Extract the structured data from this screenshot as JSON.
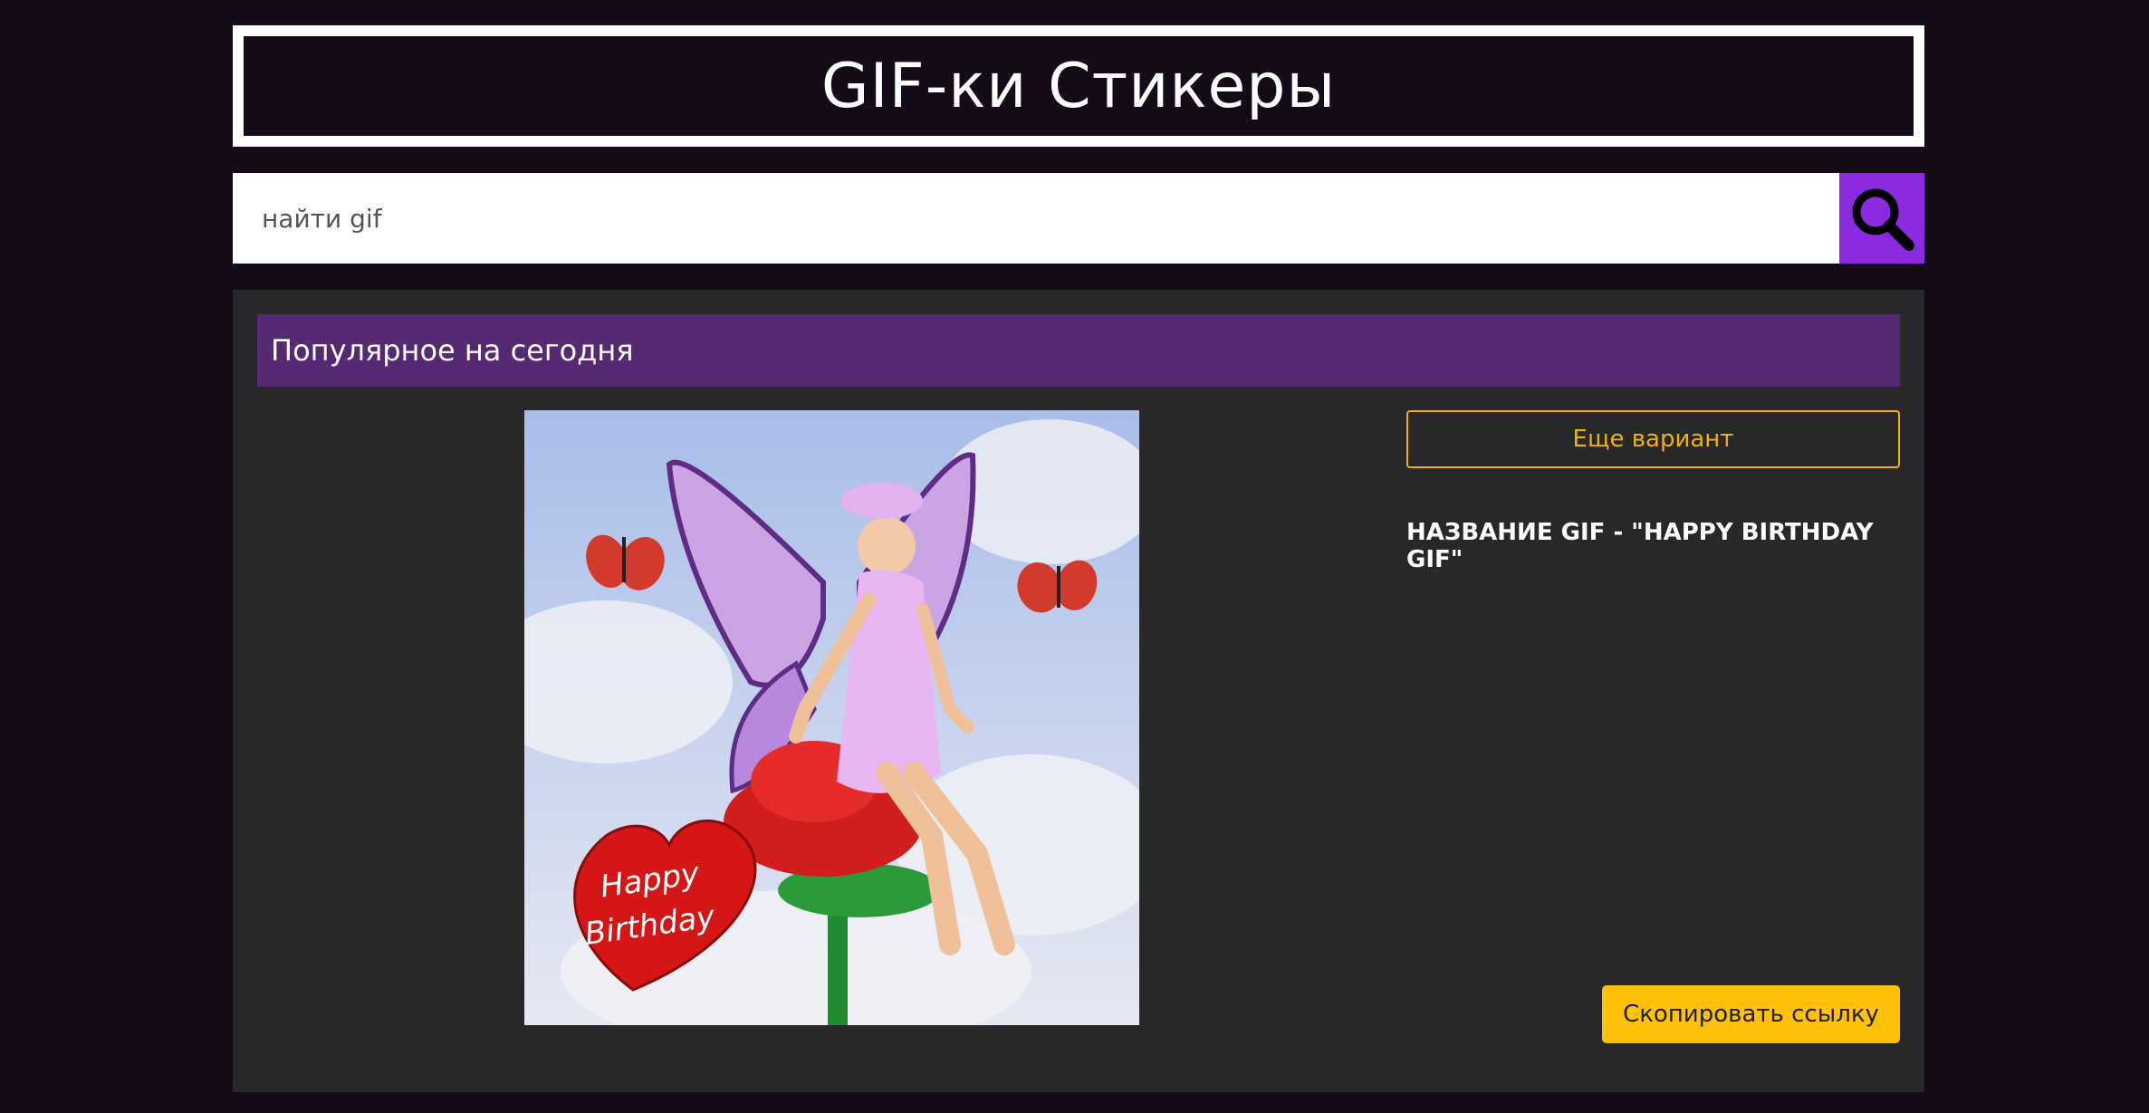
{
  "header": {
    "title": "GIF-ки Стикеры"
  },
  "search": {
    "placeholder": "найти gif",
    "value": "",
    "button_icon": "search-icon"
  },
  "popular": {
    "title": "Популярное на сегодня",
    "gif_image_text": "Happy Birthday",
    "more_button": "Еще вариант",
    "gif_name": "НАЗВАНИЕ GIF - \"HAPPY BIRTHDAY GIF\"",
    "copy_button": "Скопировать ссылку"
  },
  "colors": {
    "page_bg": "#150a18",
    "panel_bg": "#28282a",
    "panel_header_bg": "#552a72",
    "search_button_bg": "#8a2be2",
    "accent": "#ffc107"
  }
}
